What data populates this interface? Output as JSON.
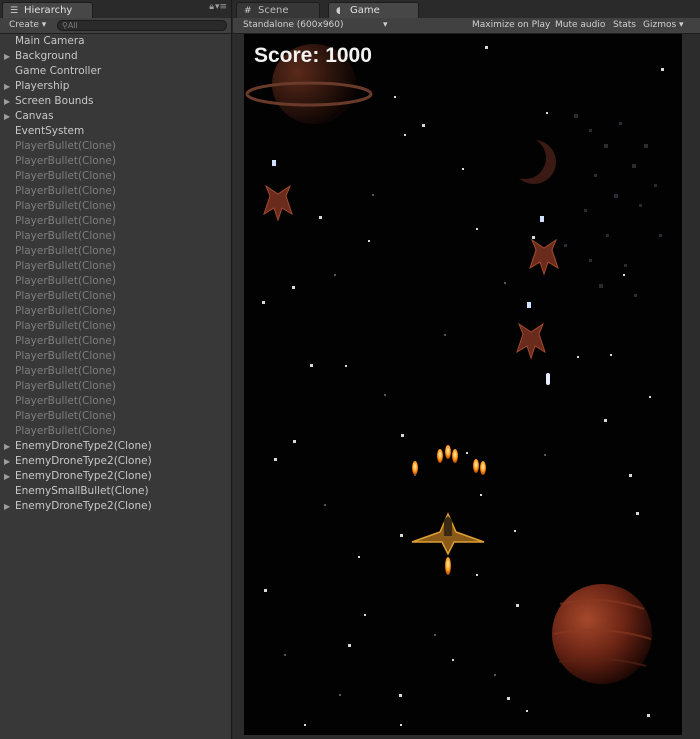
{
  "hierarchy": {
    "tab_label": "Hierarchy",
    "create_label": "Create",
    "search_placeholder": "All",
    "items": [
      {
        "label": "Main Camera",
        "expandable": false,
        "dim": false
      },
      {
        "label": "Background",
        "expandable": true,
        "dim": false
      },
      {
        "label": "Game Controller",
        "expandable": false,
        "dim": false
      },
      {
        "label": "Playership",
        "expandable": true,
        "dim": false
      },
      {
        "label": "Screen Bounds",
        "expandable": true,
        "dim": false
      },
      {
        "label": "Canvas",
        "expandable": true,
        "dim": false
      },
      {
        "label": "EventSystem",
        "expandable": false,
        "dim": false
      },
      {
        "label": "PlayerBullet(Clone)",
        "expandable": false,
        "dim": true
      },
      {
        "label": "PlayerBullet(Clone)",
        "expandable": false,
        "dim": true
      },
      {
        "label": "PlayerBullet(Clone)",
        "expandable": false,
        "dim": true
      },
      {
        "label": "PlayerBullet(Clone)",
        "expandable": false,
        "dim": true
      },
      {
        "label": "PlayerBullet(Clone)",
        "expandable": false,
        "dim": true
      },
      {
        "label": "PlayerBullet(Clone)",
        "expandable": false,
        "dim": true
      },
      {
        "label": "PlayerBullet(Clone)",
        "expandable": false,
        "dim": true
      },
      {
        "label": "PlayerBullet(Clone)",
        "expandable": false,
        "dim": true
      },
      {
        "label": "PlayerBullet(Clone)",
        "expandable": false,
        "dim": true
      },
      {
        "label": "PlayerBullet(Clone)",
        "expandable": false,
        "dim": true
      },
      {
        "label": "PlayerBullet(Clone)",
        "expandable": false,
        "dim": true
      },
      {
        "label": "PlayerBullet(Clone)",
        "expandable": false,
        "dim": true
      },
      {
        "label": "PlayerBullet(Clone)",
        "expandable": false,
        "dim": true
      },
      {
        "label": "PlayerBullet(Clone)",
        "expandable": false,
        "dim": true
      },
      {
        "label": "PlayerBullet(Clone)",
        "expandable": false,
        "dim": true
      },
      {
        "label": "PlayerBullet(Clone)",
        "expandable": false,
        "dim": true
      },
      {
        "label": "PlayerBullet(Clone)",
        "expandable": false,
        "dim": true
      },
      {
        "label": "PlayerBullet(Clone)",
        "expandable": false,
        "dim": true
      },
      {
        "label": "PlayerBullet(Clone)",
        "expandable": false,
        "dim": true
      },
      {
        "label": "PlayerBullet(Clone)",
        "expandable": false,
        "dim": true
      },
      {
        "label": "EnemyDroneType2(Clone)",
        "expandable": true,
        "dim": false
      },
      {
        "label": "EnemyDroneType2(Clone)",
        "expandable": true,
        "dim": false
      },
      {
        "label": "EnemyDroneType2(Clone)",
        "expandable": true,
        "dim": false
      },
      {
        "label": "EnemySmallBullet(Clone)",
        "expandable": false,
        "dim": false
      },
      {
        "label": "EnemyDroneType2(Clone)",
        "expandable": true,
        "dim": false
      }
    ]
  },
  "tabs": {
    "scene_label": "Scene",
    "game_label": "Game"
  },
  "game_toolbar": {
    "resolution_label": "Standalone (600x960)",
    "maximize_label": "Maximize on Play",
    "mute_label": "Mute audio",
    "stats_label": "Stats",
    "gizmos_label": "Gizmos"
  },
  "game": {
    "score_text": "Score: 1000"
  },
  "icons": {
    "hierarchy_tab": "hierarchy-list-icon",
    "scene_tab": "scene-grid-icon",
    "game_tab": "game-pacman-icon",
    "lock": "lock-icon",
    "menu": "panel-menu-icon",
    "expand": "expand-arrow-icon"
  },
  "colors": {
    "panel_bg": "#383838",
    "tab_bar_bg": "#2a2a2a",
    "viewport_bg": "#020202",
    "score_text": "#f2f2f2",
    "dim_text": "#7e7e7e",
    "normal_text": "#c8c8c8"
  }
}
